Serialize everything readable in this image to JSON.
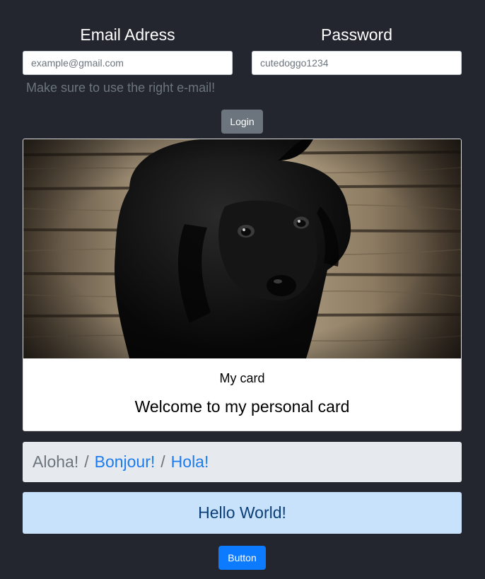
{
  "login_form": {
    "email": {
      "label": "Email Adress",
      "placeholder": "example@gmail.com",
      "help": "Make sure to use the right e-mail!"
    },
    "password": {
      "label": "Password",
      "placeholder": "cutedoggo1234"
    },
    "login_label": "Login"
  },
  "card": {
    "image": {
      "subject": "black puppy on wooden floor"
    },
    "title": "My card",
    "text": "Welcome to my personal card"
  },
  "breadcrumb": {
    "current": "Aloha!",
    "sep": "/",
    "links": [
      "Bonjour!",
      "Hola!"
    ]
  },
  "alert": {
    "text": "Hello World!"
  },
  "primary_button": {
    "label": "Button"
  },
  "colors": {
    "page_background": "#23252f",
    "secondary_button": "#6c757d",
    "primary_button": "#0d7bff",
    "link": "#1b7cf0",
    "alert_background": "#c9e2fc",
    "alert_text": "#0b3f78",
    "breadcrumb_background": "#e6e9ed"
  }
}
